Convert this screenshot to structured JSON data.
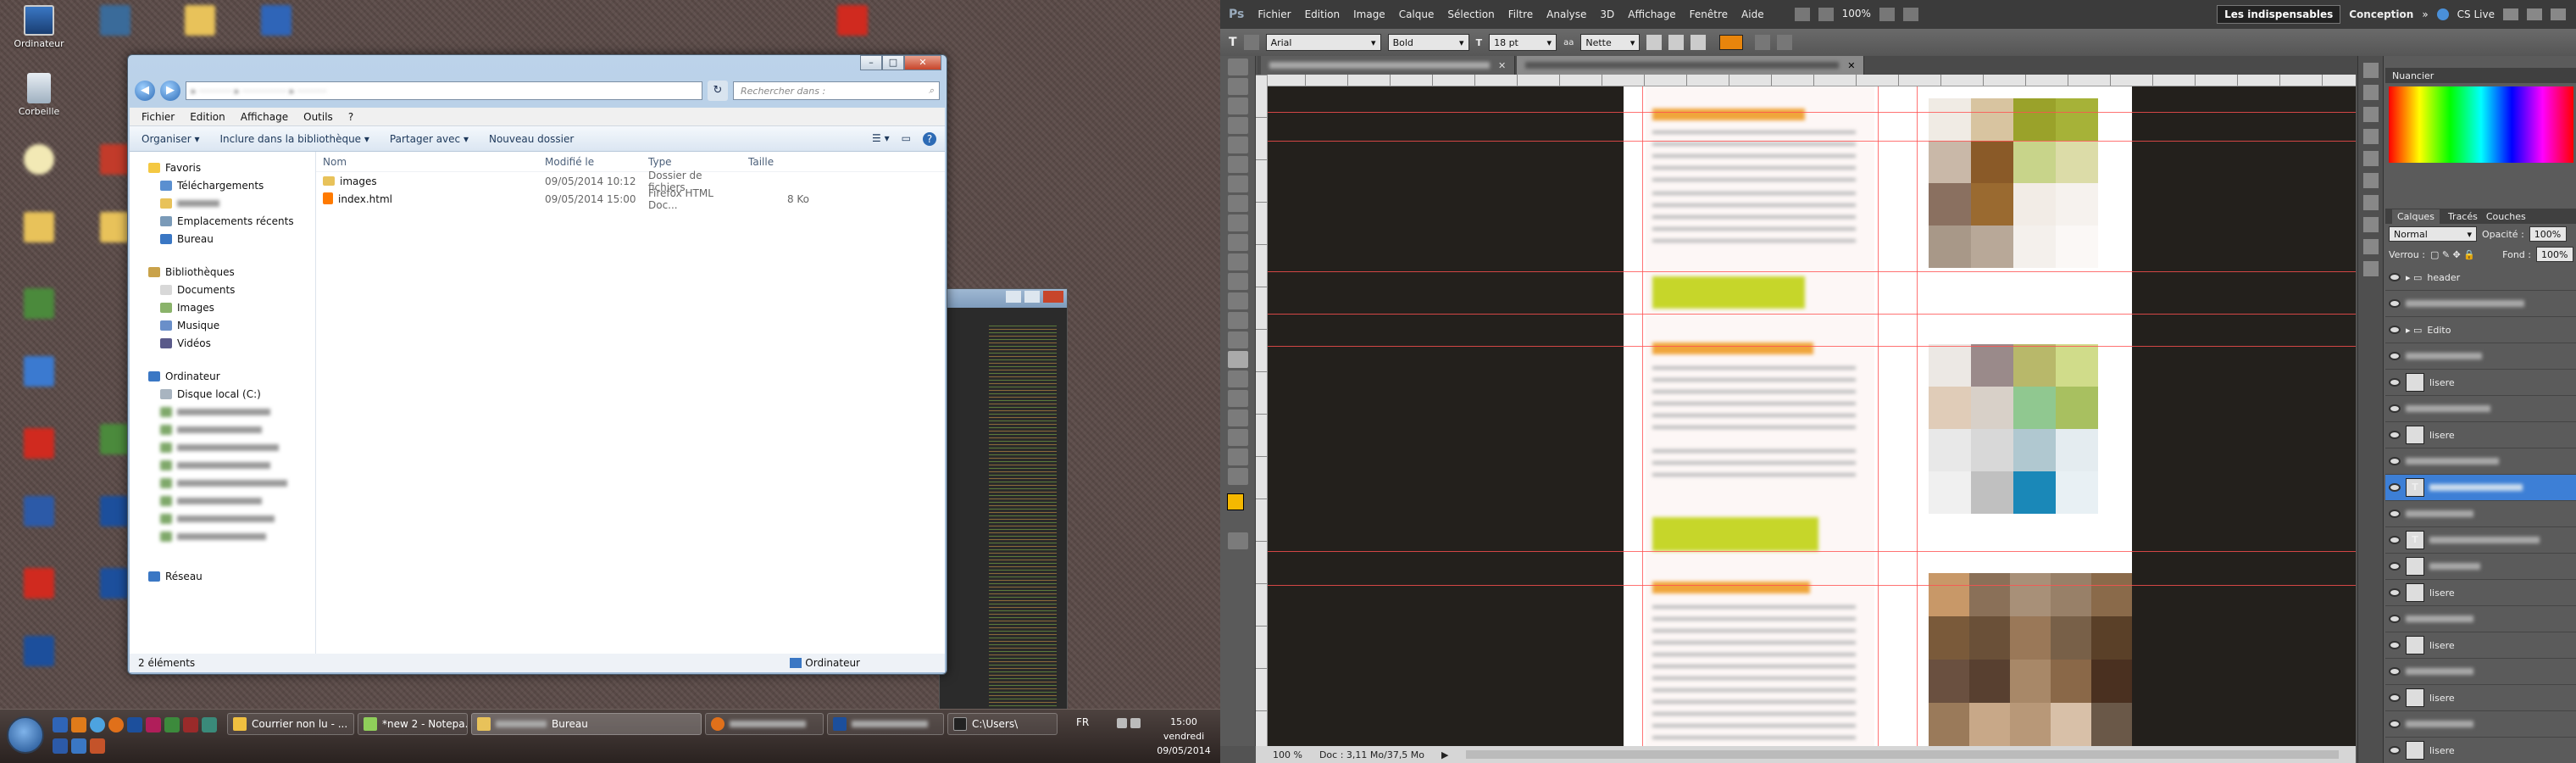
{
  "desktop": {
    "icons": [
      {
        "label": "Ordinateur"
      },
      {
        "label": "Corbeille"
      }
    ]
  },
  "explorer": {
    "address_placeholder": "",
    "search_placeholder": "Rechercher dans : ",
    "menu": [
      "Fichier",
      "Edition",
      "Affichage",
      "Outils",
      "?"
    ],
    "commands": [
      "Organiser ▾",
      "Inclure dans la bibliothèque ▾",
      "Partager avec ▾",
      "Nouveau dossier"
    ],
    "nav": {
      "favorites_title": "Favoris",
      "favorites": [
        "Téléchargements",
        "",
        "Emplacements récents",
        "Bureau"
      ],
      "libraries_title": "Bibliothèques",
      "libraries": [
        "Documents",
        "Images",
        "Musique",
        "Vidéos"
      ],
      "computer_title": "Ordinateur",
      "drives": [
        "Disque local (C:)"
      ],
      "network": "Réseau"
    },
    "columns": [
      "Nom",
      "Modifié le",
      "Type",
      "Taille"
    ],
    "files": [
      {
        "name": "images",
        "date": "09/05/2014 10:12",
        "type": "Dossier de fichiers",
        "size": ""
      },
      {
        "name": "index.html",
        "date": "09/05/2014 15:00",
        "type": "Firefox HTML Doc...",
        "size": "8 Ko"
      }
    ],
    "status_left": "2 éléments",
    "status_right": "Ordinateur"
  },
  "taskbar": {
    "buttons": [
      "Courrier non lu - ...",
      "*new 2 - Notepa...",
      "Bureau",
      "",
      "",
      "C:\\Users\\"
    ],
    "lang": "FR",
    "time": "15:00",
    "day": "vendredi",
    "date": "09/05/2014"
  },
  "photoshop": {
    "logo": "Ps",
    "menu": [
      "Fichier",
      "Edition",
      "Image",
      "Calque",
      "Sélection",
      "Filtre",
      "Analyse",
      "3D",
      "Affichage",
      "Fenêtre",
      "Aide"
    ],
    "zoom": "100%",
    "workspace_active": "Les indispensables",
    "workspace_other": "Conception",
    "cslive": "CS Live",
    "font": "Arial",
    "style": "Bold",
    "size": "18 pt",
    "aa": "Nette",
    "tab1": "",
    "tab2": "",
    "status_zoom": "100 %",
    "status_doc": "Doc : 3,11 Mo/37,5 Mo",
    "swatches_title": "Nuancier",
    "layers_tabs": [
      "Calques",
      "Tracés",
      "Couches"
    ],
    "blend": "Normal",
    "opacity_label": "Opacité :",
    "opacity": "100%",
    "lock_label": "Verrou :",
    "fill_label": "Fond :",
    "fill": "100%",
    "layers": [
      "header",
      "",
      "Edito",
      "",
      "lisere",
      "",
      "lisere",
      "",
      "",
      "",
      "",
      "",
      "lisere",
      "",
      "lisere",
      "",
      "lisere",
      "",
      "lisere"
    ]
  },
  "colors": {
    "accent_green": "#c6d62a",
    "ps_orange": "#e8850c"
  }
}
